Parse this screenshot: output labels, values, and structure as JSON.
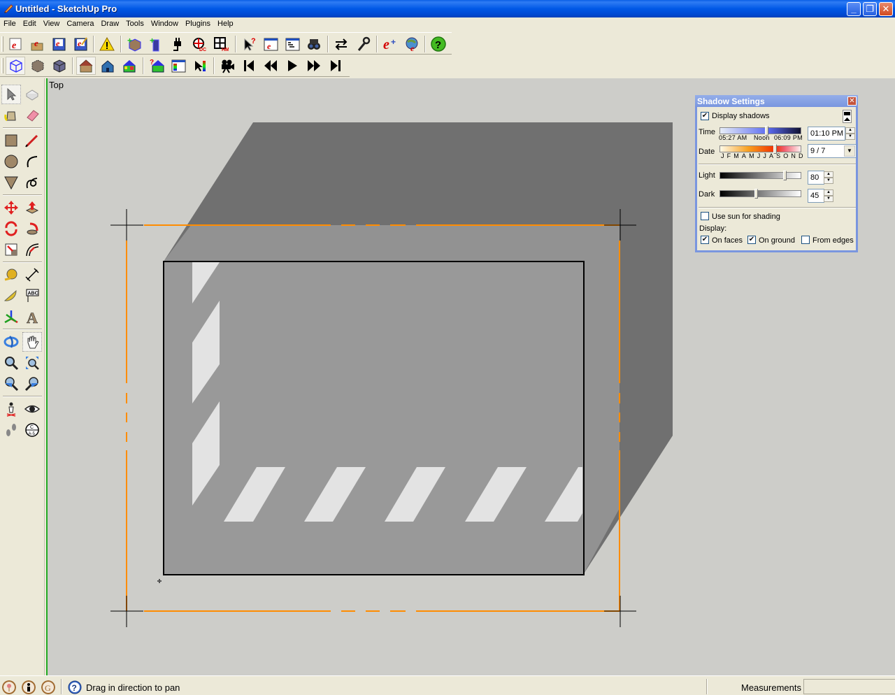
{
  "window": {
    "title": "Untitled - SketchUp Pro",
    "controls": [
      "minimize",
      "restore",
      "close"
    ]
  },
  "menu": [
    "File",
    "Edit",
    "View",
    "Camera",
    "Draw",
    "Tools",
    "Window",
    "Plugins",
    "Help"
  ],
  "toolbar_top": [
    "new-document-icon",
    "open-icon",
    "save-icon",
    "save-as-icon",
    "warning-icon",
    "add-component-icon",
    "add-wall-icon",
    "plug-icon",
    "dynamic-component-icon",
    "window-grid-icon",
    "help-pointer-icon",
    "web-window-icon",
    "list-window-icon",
    "binoculars-icon",
    "swap-arrows-icon",
    "wrench-icon",
    "extension-icon",
    "globe-extension-icon",
    "help-icon"
  ],
  "toolbar_bottom": [
    "xray-cube-icon",
    "wireframe-cube-icon",
    "shaded-cube-icon",
    "house-textured-icon",
    "house-blue-icon",
    "house-colored-icon",
    "house-query-icon",
    "palette-window-icon",
    "color-pointer-icon",
    "camera-icon",
    "first-frame-icon",
    "rewind-icon",
    "play-icon",
    "fast-forward-icon",
    "last-frame-icon"
  ],
  "left_tools": [
    "select-icon",
    "make-component-icon",
    "paint-bucket-icon",
    "eraser-icon",
    "rectangle-icon",
    "pencil-icon",
    "circle-icon",
    "arc-icon",
    "polygon-icon",
    "freehand-icon",
    "move-icon",
    "push-pull-icon",
    "rotate-icon",
    "follow-me-icon",
    "scale-icon",
    "offset-icon",
    "tape-measure-icon",
    "dimension-icon",
    "protractor-icon",
    "text-icon",
    "axes-icon",
    "3d-text-icon",
    "orbit-icon",
    "pan-icon",
    "zoom-icon",
    "zoom-extents-icon",
    "previous-view-icon",
    "next-view-icon",
    "position-camera-icon",
    "look-around-icon",
    "walk-icon",
    "section-plane-icon"
  ],
  "viewport": {
    "view_name": "Top",
    "colors": {
      "background": "#cdcdc9",
      "shadow": "#707070",
      "face": "#999999",
      "highlight": "#e3e3e3",
      "guide": "#ff8c00",
      "edge": "#000000"
    }
  },
  "shadow_settings": {
    "title": "Shadow Settings",
    "display_shadows_label": "Display shadows",
    "display_shadows": true,
    "time_label": "Time",
    "time_ticks": [
      "05:27 AM",
      "Noon",
      "06:09 PM"
    ],
    "time_value": "01:10 PM",
    "time_slider": 0.58,
    "date_label": "Date",
    "date_ticks": [
      "J",
      "F",
      "M",
      "A",
      "M",
      "J",
      "J",
      "A",
      "S",
      "O",
      "N",
      "D"
    ],
    "date_value": "9 / 7",
    "date_slider": 0.68,
    "light_label": "Light",
    "light_value": "80",
    "light_slider": 0.8,
    "dark_label": "Dark",
    "dark_value": "45",
    "dark_slider": 0.45,
    "use_sun_label": "Use sun for shading",
    "use_sun": false,
    "display_label": "Display:",
    "on_faces_label": "On faces",
    "on_faces": true,
    "on_ground_label": "On ground",
    "on_ground": true,
    "from_edges_label": "From edges",
    "from_edges": false
  },
  "status": {
    "icons": [
      "geo-location-icon",
      "credits-icon",
      "google-sign-in-icon",
      "instructor-help-icon"
    ],
    "message": "Drag in direction to pan",
    "measurements_label": "Measurements",
    "measurements_value": ""
  }
}
